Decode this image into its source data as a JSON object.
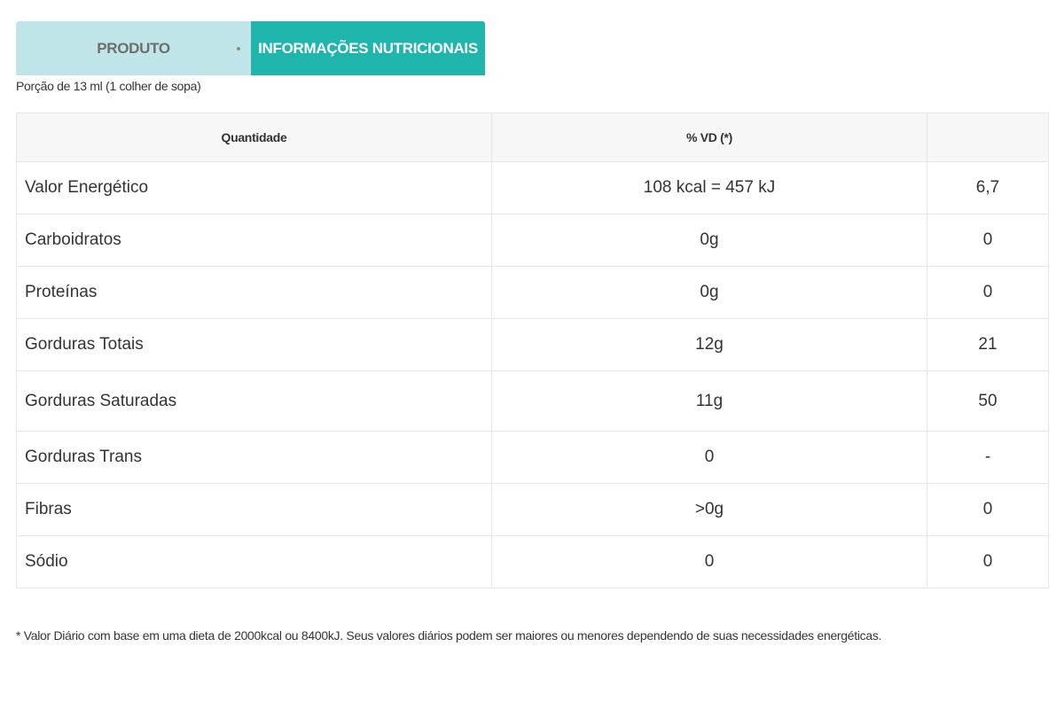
{
  "tabs": {
    "produto": "PRODUTO",
    "info": "INFORMAÇÕES NUTRICIONAIS",
    "active": "info"
  },
  "colors": {
    "tab_active": "#1fb5ac",
    "tab_inactive": "#bfe5e8",
    "header_bg": "#f7f7f7"
  },
  "portion": "Porção de 13 ml (1 colher de sopa)",
  "table": {
    "headers": [
      "Quantidade",
      "% VD (*)",
      ""
    ],
    "rows": [
      {
        "name": "Valor Energético",
        "amount": "108 kcal = 457 kJ",
        "vd": "6,7"
      },
      {
        "name": "Carboidratos",
        "amount": "0g",
        "vd": "0"
      },
      {
        "name": "Proteínas",
        "amount": "0g",
        "vd": "0"
      },
      {
        "name": "Gorduras Totais",
        "amount": "12g",
        "vd": "21"
      },
      {
        "name": "Gorduras Saturadas",
        "amount": "11g",
        "vd": "50"
      },
      {
        "name": "Gorduras Trans",
        "amount": "0",
        "vd": "-"
      },
      {
        "name": "Fibras",
        "amount": ">0g",
        "vd": "0"
      },
      {
        "name": "Sódio",
        "amount": "0",
        "vd": "0"
      }
    ]
  },
  "footnote": "* Valor Diário com base em uma dieta de 2000kcal ou 8400kJ. Seus valores diários podem ser maiores ou menores dependendo de suas necessidades energéticas."
}
